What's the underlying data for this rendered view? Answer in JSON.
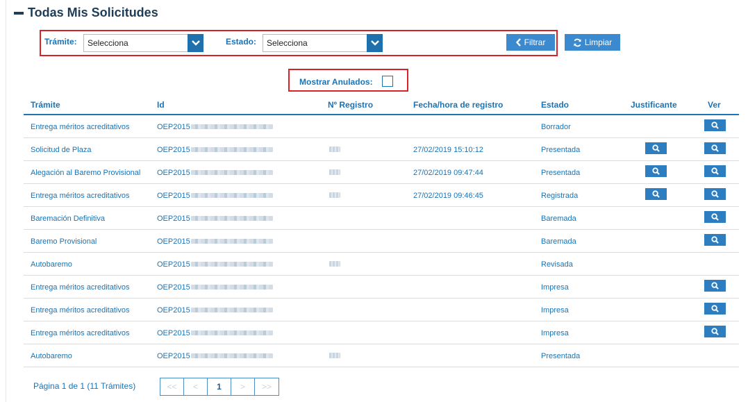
{
  "header": {
    "title": "Todas Mis Solicitudes"
  },
  "filters": {
    "tramite_label": "Trámite:",
    "tramite_value": "Selecciona",
    "estado_label": "Estado:",
    "estado_value": "Selecciona",
    "filtrar_label": "Filtrar",
    "limpiar_label": "Limpiar",
    "mostrar_anulados_label": "Mostrar Anulados:"
  },
  "table": {
    "columns": [
      "Trámite",
      "Id",
      "Nº Registro",
      "Fecha/hora de registro",
      "Estado",
      "Justificante",
      "Ver"
    ],
    "rows": [
      {
        "tramite": "Entrega méritos acreditativos",
        "id": "OEP2015",
        "registro_blurred": false,
        "fecha": "",
        "estado": "Borrador",
        "justificante": false,
        "ver": true
      },
      {
        "tramite": "Solicitud de Plaza",
        "id": "OEP2015",
        "registro_blurred": true,
        "fecha": "27/02/2019 15:10:12",
        "estado": "Presentada",
        "justificante": true,
        "ver": true
      },
      {
        "tramite": "Alegación al Baremo Provisional",
        "id": "OEP2015",
        "registro_blurred": true,
        "fecha": "27/02/2019 09:47:44",
        "estado": "Presentada",
        "justificante": true,
        "ver": true
      },
      {
        "tramite": "Entrega méritos acreditativos",
        "id": "OEP2015",
        "registro_blurred": true,
        "fecha": "27/02/2019 09:46:45",
        "estado": "Registrada",
        "justificante": true,
        "ver": true
      },
      {
        "tramite": "Baremación Definitiva",
        "id": "OEP2015",
        "registro_blurred": false,
        "fecha": "",
        "estado": "Baremada",
        "justificante": false,
        "ver": true
      },
      {
        "tramite": "Baremo Provisional",
        "id": "OEP2015",
        "registro_blurred": false,
        "fecha": "",
        "estado": "Baremada",
        "justificante": false,
        "ver": true
      },
      {
        "tramite": "Autobaremo",
        "id": "OEP2015",
        "registro_blurred": true,
        "fecha": "",
        "estado": "Revisada",
        "justificante": false,
        "ver": false
      },
      {
        "tramite": "Entrega méritos acreditativos",
        "id": "OEP2015",
        "registro_blurred": false,
        "fecha": "",
        "estado": "Impresa",
        "justificante": false,
        "ver": true
      },
      {
        "tramite": "Entrega méritos acreditativos",
        "id": "OEP2015",
        "registro_blurred": false,
        "fecha": "",
        "estado": "Impresa",
        "justificante": false,
        "ver": true
      },
      {
        "tramite": "Entrega méritos acreditativos",
        "id": "OEP2015",
        "registro_blurred": false,
        "fecha": "",
        "estado": "Impresa",
        "justificante": false,
        "ver": true
      },
      {
        "tramite": "Autobaremo",
        "id": "OEP2015",
        "registro_blurred": true,
        "fecha": "",
        "estado": "Presentada",
        "justificante": false,
        "ver": false
      }
    ]
  },
  "pagination": {
    "summary": "Página 1 de 1 (11 Trámites)",
    "first": "<<",
    "prev": "<",
    "current": "1",
    "next": ">",
    "last": ">>"
  },
  "colors": {
    "accent": "#1a73b5",
    "button": "#2d7ec1",
    "highlight_border": "#d7222a",
    "title": "#1f3d57"
  },
  "icons": {
    "collapse": "minus-icon",
    "dropdown": "chevron-down-icon",
    "filter": "chevron-left-icon",
    "clear": "refresh-icon",
    "view": "search-icon"
  }
}
